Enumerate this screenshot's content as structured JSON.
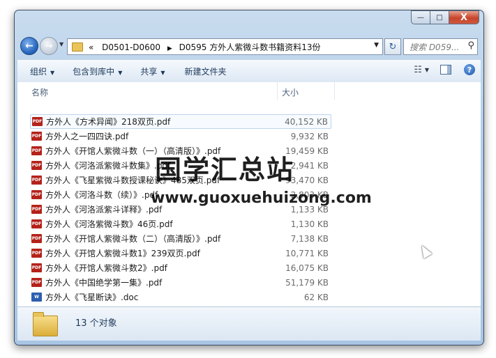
{
  "window": {
    "controls": {
      "minimize": "—",
      "maximize": "□",
      "close": "X"
    }
  },
  "nav": {
    "back_glyph": "←",
    "forward_glyph": "→",
    "address_prefix": "«",
    "address_crumbs": [
      "D0501-D0600",
      "D0595 方外人紫微斗数书籍资料13份"
    ],
    "search_placeholder": "搜索 D059..."
  },
  "toolbar": {
    "organize": "组织",
    "include_library": "包含到库中",
    "share": "共享",
    "new_folder": "新建文件夹"
  },
  "columns": {
    "name": "名称",
    "size": "大小"
  },
  "files": [
    {
      "name": "方外人《方术异闻》218双页.pdf",
      "size": "40,152 KB",
      "type": "pdf"
    },
    {
      "name": "方外人之一四四诀.pdf",
      "size": "9,932 KB",
      "type": "pdf"
    },
    {
      "name": "方外人《开馆人紫微斗数（一）（高清版）》.pdf",
      "size": "19,459 KB",
      "type": "pdf"
    },
    {
      "name": "方外人《河洛派紫微斗数集》.pdf",
      "size": "2,941 KB",
      "type": "pdf"
    },
    {
      "name": "方外人《飞星紫微斗数授课秘诀》485双页.pdf",
      "size": "93,470 KB",
      "type": "pdf"
    },
    {
      "name": "方外人《河洛斗数（续）》.pdf",
      "size": "2,803 KB",
      "type": "pdf"
    },
    {
      "name": "方外人《河洛派紫斗详释》.pdf",
      "size": "1,133 KB",
      "type": "pdf"
    },
    {
      "name": "方外人《河洛紫微斗数》46页.pdf",
      "size": "1,130 KB",
      "type": "pdf"
    },
    {
      "name": "方外人《开馆人紫微斗数（二）（高清版）》.pdf",
      "size": "7,138 KB",
      "type": "pdf"
    },
    {
      "name": "方外人《开馆人紫微斗数1》239双页.pdf",
      "size": "10,771 KB",
      "type": "pdf"
    },
    {
      "name": "方外人《开馆人紫微斗数2》.pdf",
      "size": "16,075 KB",
      "type": "pdf"
    },
    {
      "name": "方外人《中国绝学第一集》.pdf",
      "size": "51,179 KB",
      "type": "pdf"
    },
    {
      "name": "方外人《飞星断诀》.doc",
      "size": "62 KB",
      "type": "doc"
    }
  ],
  "icon_labels": {
    "pdf": "PDF",
    "doc": "W"
  },
  "status": {
    "count_text": "13 个对象"
  },
  "watermark": {
    "title": "国学汇总站",
    "url": "www.guoxuehuizong.com"
  }
}
